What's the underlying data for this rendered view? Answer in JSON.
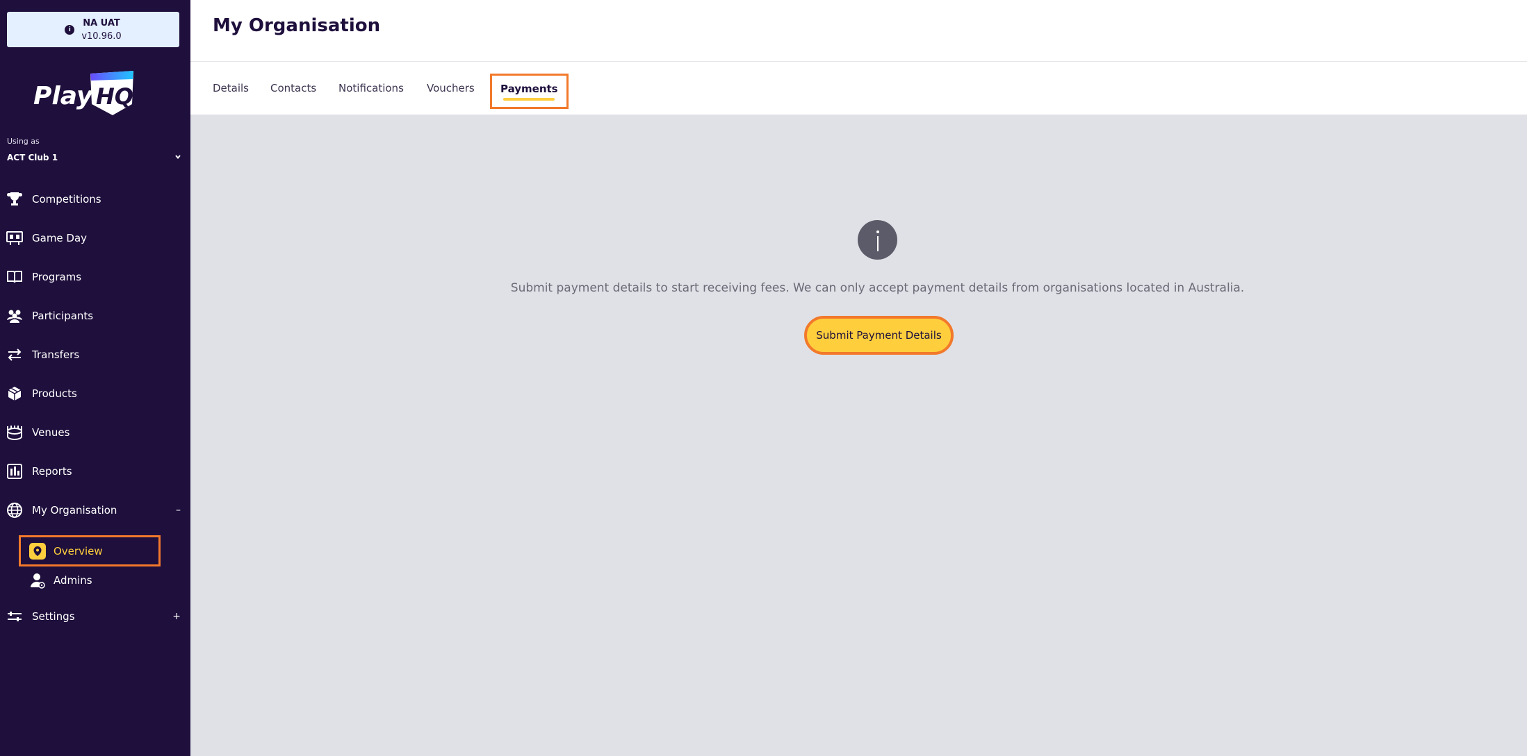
{
  "env": {
    "name": "NA UAT",
    "version": "v10.96.0"
  },
  "brand": {
    "logo_text": "Play",
    "logo_mark": "HQ"
  },
  "sidebar": {
    "using_as_label": "Using as",
    "current_org": "ACT Club 1",
    "items": [
      {
        "label": "Competitions",
        "icon": "trophy-icon"
      },
      {
        "label": "Game Day",
        "icon": "scoreboard-icon"
      },
      {
        "label": "Programs",
        "icon": "book-icon"
      },
      {
        "label": "Participants",
        "icon": "users-icon"
      },
      {
        "label": "Transfers",
        "icon": "transfer-arrows-icon"
      },
      {
        "label": "Products",
        "icon": "box-icon"
      },
      {
        "label": "Venues",
        "icon": "stadium-icon"
      },
      {
        "label": "Reports",
        "icon": "chart-icon"
      },
      {
        "label": "My Organisation",
        "icon": "globe-icon",
        "toggle": "–"
      },
      {
        "label": "Settings",
        "icon": "sliders-icon",
        "toggle": "+"
      }
    ],
    "sub_items": [
      {
        "label": "Overview",
        "icon": "location-pin-icon"
      },
      {
        "label": "Admins",
        "icon": "admin-user-icon"
      }
    ]
  },
  "header": {
    "title": "My Organisation"
  },
  "tabs": [
    {
      "label": "Details"
    },
    {
      "label": "Contacts"
    },
    {
      "label": "Notifications"
    },
    {
      "label": "Vouchers"
    },
    {
      "label": "Payments"
    }
  ],
  "main": {
    "message": "Submit payment details to start receiving fees. We can only accept payment details from organisations located in Australia.",
    "submit_label": "Submit Payment Details"
  },
  "colors": {
    "sidebar_bg": "#1e0f3c",
    "accent_yellow": "#ffce3d",
    "highlight_orange": "#f2792b",
    "content_bg": "#dfe1e6"
  }
}
